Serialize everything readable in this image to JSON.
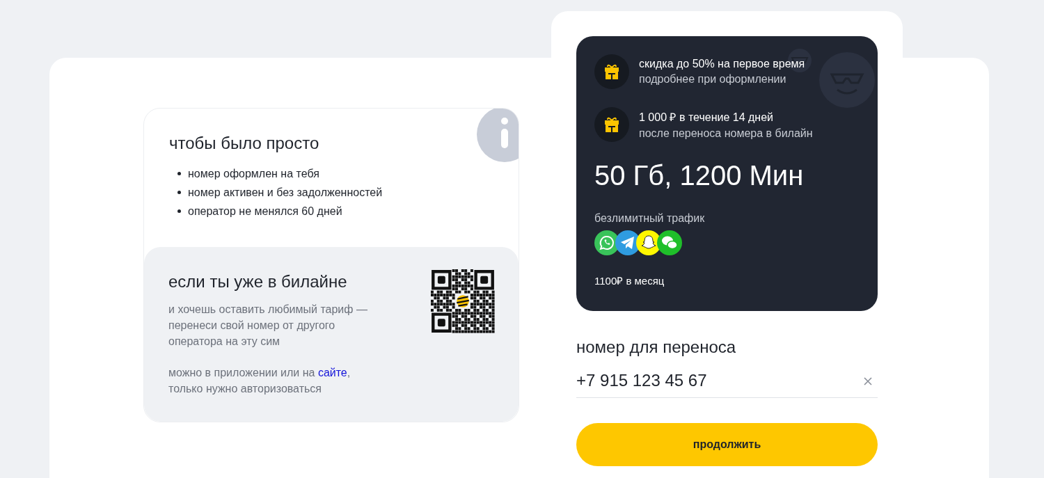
{
  "requirements": {
    "title": "чтобы было просто",
    "items": [
      "номер оформлен на тебя",
      "номер активен и без задолженностей",
      "оператор не менялся 60 дней"
    ]
  },
  "beeline": {
    "title": "если ты уже в билайне",
    "text": "и хочешь оставить любимый тариф — перенеси свой номер от другого оператора на эту сим",
    "note_before": "можно в приложении или на",
    "link": "сайте",
    "note_after": ", только нужно авторизоваться"
  },
  "tariff": {
    "perks": [
      {
        "title": "скидка до 50% на первое время",
        "subtitle": "подробнее при оформлении"
      },
      {
        "title": "1 000 ₽ в течение 14 дней",
        "subtitle": "после переноса номера в билайн"
      }
    ],
    "headline": "50 Гб, 1200 Мин",
    "traffic": "безлимитный трафик",
    "price": "1100₽ в месяц"
  },
  "form": {
    "label": "номер для переноса",
    "value": "+7 915 123 45 67",
    "button": "продолжить"
  }
}
